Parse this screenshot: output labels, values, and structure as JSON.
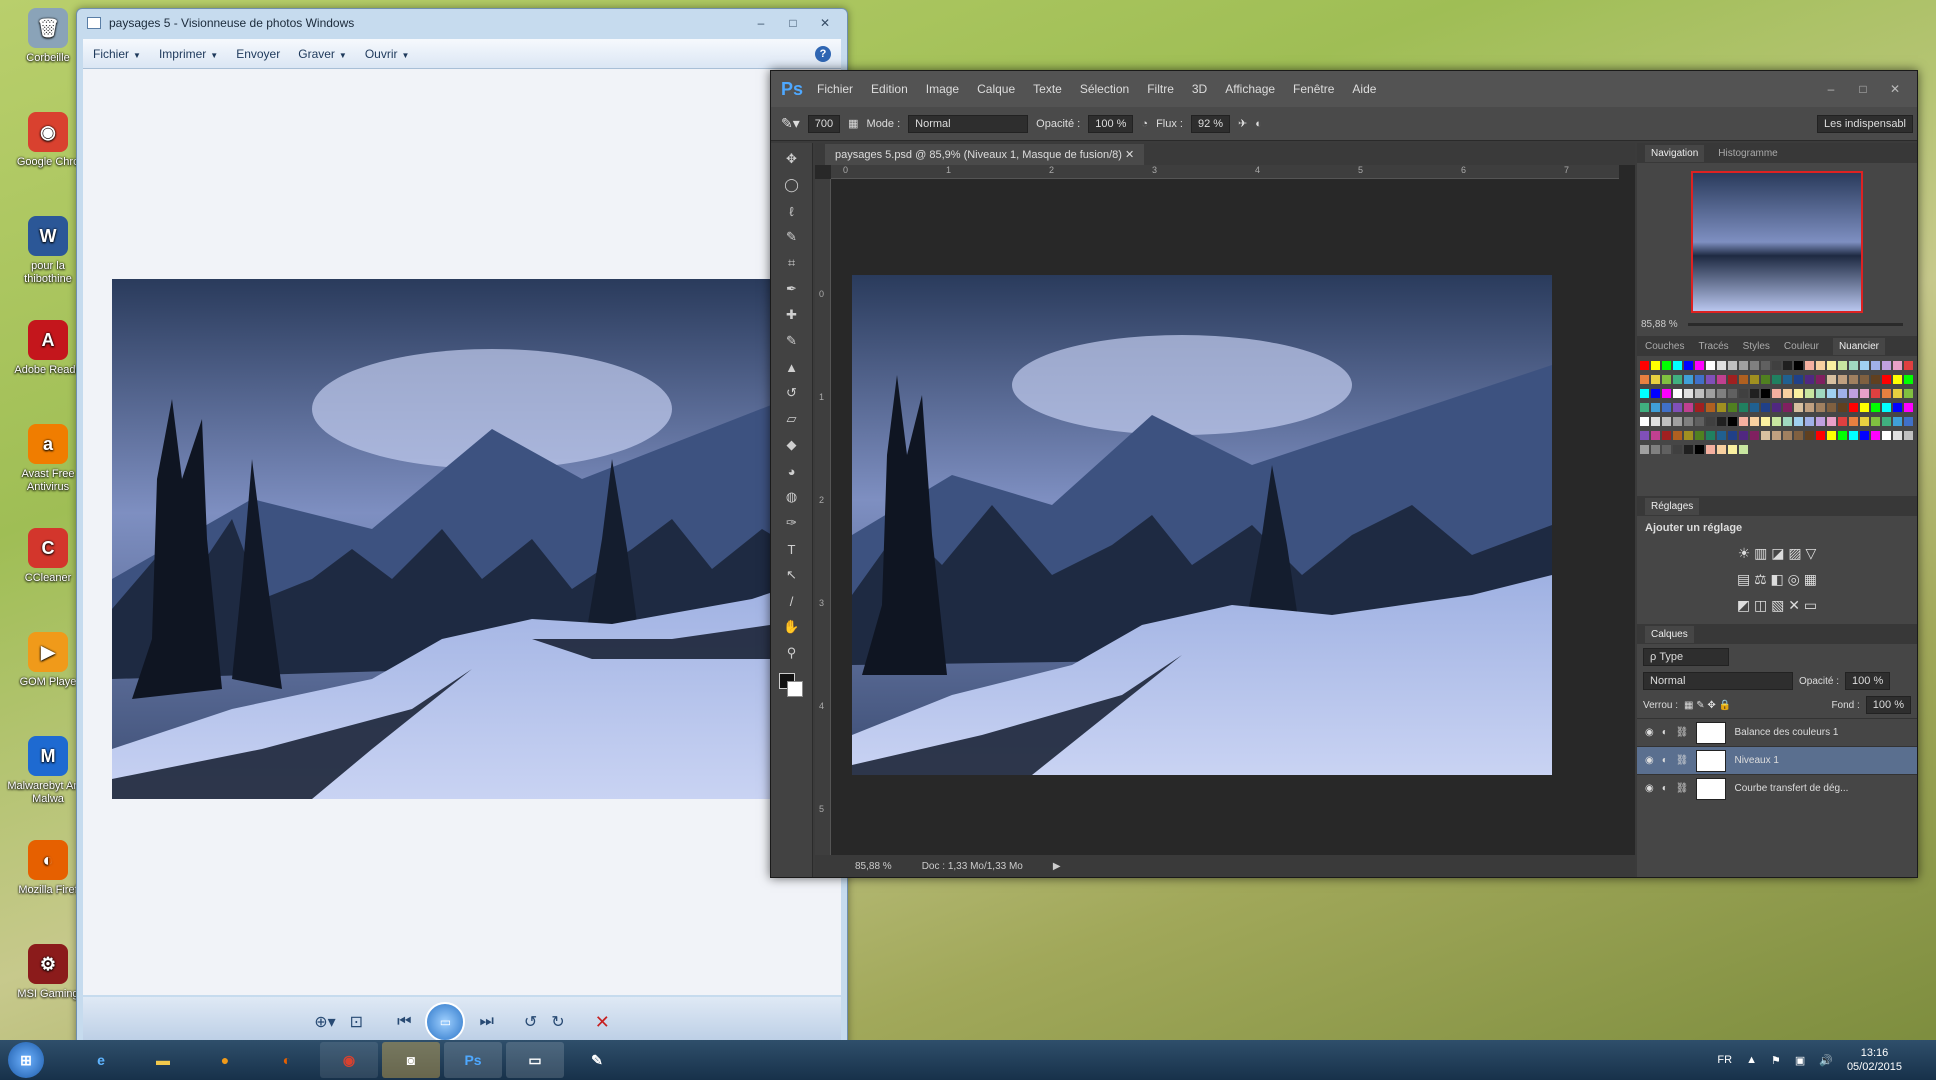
{
  "desktop": {
    "icons": [
      {
        "label": "Corbeille",
        "icon": "recycle-bin-icon",
        "glyph": "🗑",
        "color": "#8aa3b8"
      },
      {
        "label": "Google Chro",
        "icon": "chrome-icon",
        "glyph": "◉",
        "color": "#d9412f"
      },
      {
        "label": "pour la thibothine",
        "icon": "word-doc-icon",
        "glyph": "W",
        "color": "#2b5797"
      },
      {
        "label": "Adobe Reade",
        "icon": "adobe-reader-icon",
        "glyph": "A",
        "color": "#c4161c"
      },
      {
        "label": "Avast Free Antivirus",
        "icon": "avast-icon",
        "glyph": "a",
        "color": "#f07d00"
      },
      {
        "label": "CCleaner",
        "icon": "ccleaner-icon",
        "glyph": "C",
        "color": "#d3362c"
      },
      {
        "label": "GOM Playe",
        "icon": "gom-player-icon",
        "glyph": "▶",
        "color": "#f09a1a"
      },
      {
        "label": "Malwarebyt Anti-Malwa",
        "icon": "malwarebytes-icon",
        "glyph": "M",
        "color": "#1e6ad1"
      },
      {
        "label": "Mozilla Firef",
        "icon": "firefox-icon",
        "glyph": "◐",
        "color": "#e66000"
      },
      {
        "label": "MSI Gaming",
        "icon": "msi-gaming-icon",
        "glyph": "⚙",
        "color": "#8b1b1b"
      }
    ]
  },
  "viewer": {
    "title": "paysages 5 - Visionneuse de photos Windows",
    "menu": [
      {
        "label": "Fichier",
        "dropdown": true
      },
      {
        "label": "Imprimer",
        "dropdown": true
      },
      {
        "label": "Envoyer",
        "dropdown": false
      },
      {
        "label": "Graver",
        "dropdown": true
      },
      {
        "label": "Ouvrir",
        "dropdown": true
      }
    ],
    "help": "?"
  },
  "ps": {
    "logo": "Ps",
    "menu": [
      "Fichier",
      "Edition",
      "Image",
      "Calque",
      "Texte",
      "Sélection",
      "Filtre",
      "3D",
      "Affichage",
      "Fenêtre",
      "Aide"
    ],
    "options": {
      "brush_size": "700",
      "mode_label": "Mode :",
      "mode_value": "Normal",
      "opacity_label": "Opacité :",
      "opacity_value": "100 %",
      "flow_label": "Flux :",
      "flow_value": "92 %",
      "workspace": "Les indispensabl"
    },
    "doc_tab": "paysages 5.psd @ 85,9% (Niveaux 1, Masque de fusion/8)",
    "hruler": [
      "0",
      "1",
      "2",
      "3",
      "4",
      "5",
      "6",
      "7"
    ],
    "vruler": [
      "0",
      "1",
      "2",
      "3",
      "4",
      "5"
    ],
    "status_zoom": "85,88 %",
    "status_doc": "Doc : 1,33 Mo/1,33 Mo",
    "nav_tabs": [
      "Navigation",
      "Histogramme"
    ],
    "nav_zoom": "85,88 %",
    "swatch_tabs": [
      "Couches",
      "Tracés",
      "Styles",
      "Couleur",
      "Nuancier"
    ],
    "adjust_tab": "Réglages",
    "adjust_title": "Ajouter un réglage",
    "layers_tab": "Calques",
    "layers_filter": "ρ Type",
    "blend_mode": "Normal",
    "layer_opacity_label": "Opacité :",
    "layer_opacity": "100 %",
    "lock_label": "Verrou :",
    "fill_label": "Fond :",
    "fill_value": "100 %",
    "layers": [
      {
        "name": "Balance des couleurs 1",
        "selected": false
      },
      {
        "name": "Niveaux 1",
        "selected": true
      },
      {
        "name": "Courbe transfert de dég...",
        "selected": false
      }
    ]
  },
  "taskbar": {
    "language": "FR",
    "time": "13:16",
    "date": "05/02/2015"
  },
  "colors": {
    "ps_accent": "#4ea8ff",
    "selected_layer": "#5a6f8f",
    "sky_dark": "#1f2f4a",
    "sky_light": "#c7d2ee",
    "river": "#b9c6ee"
  }
}
